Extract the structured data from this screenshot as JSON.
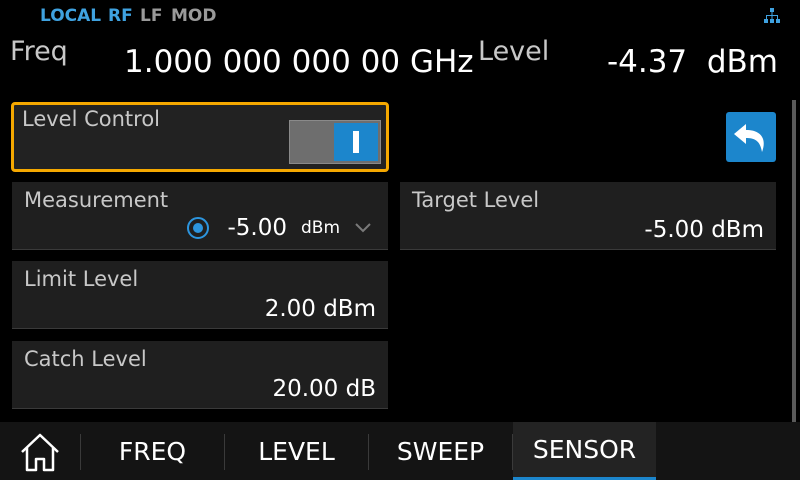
{
  "status": {
    "modes": [
      "LOCAL",
      "RF",
      "LF",
      "MOD"
    ],
    "active_color": "#3fa2e0",
    "inactive_color": "#9a9a9a",
    "network_icon": "network-icon"
  },
  "readout": {
    "freq_label": "Freq",
    "freq_value": "1.000 000 000 00 GHz",
    "level_label": "Level",
    "level_value": "-4.37  dBm"
  },
  "level_control": {
    "label": "Level Control",
    "state": "on"
  },
  "measurement": {
    "label": "Measurement",
    "value": "-5.00",
    "unit": "dBm",
    "selected": true
  },
  "target_level": {
    "label": "Target Level",
    "value": "-5.00 dBm"
  },
  "limit_level": {
    "label": "Limit Level",
    "value": "2.00 dBm"
  },
  "catch_level": {
    "label": "Catch Level",
    "value": "20.00 dB"
  },
  "nav": {
    "home_icon": "home-icon",
    "tabs": [
      {
        "label": "FREQ",
        "active": false
      },
      {
        "label": "LEVEL",
        "active": false
      },
      {
        "label": "SWEEP",
        "active": false
      },
      {
        "label": "SENSOR",
        "active": true
      }
    ]
  },
  "colors": {
    "accent": "#1c86cc",
    "focus": "#f5a800",
    "panel": "#1f1f1f"
  }
}
